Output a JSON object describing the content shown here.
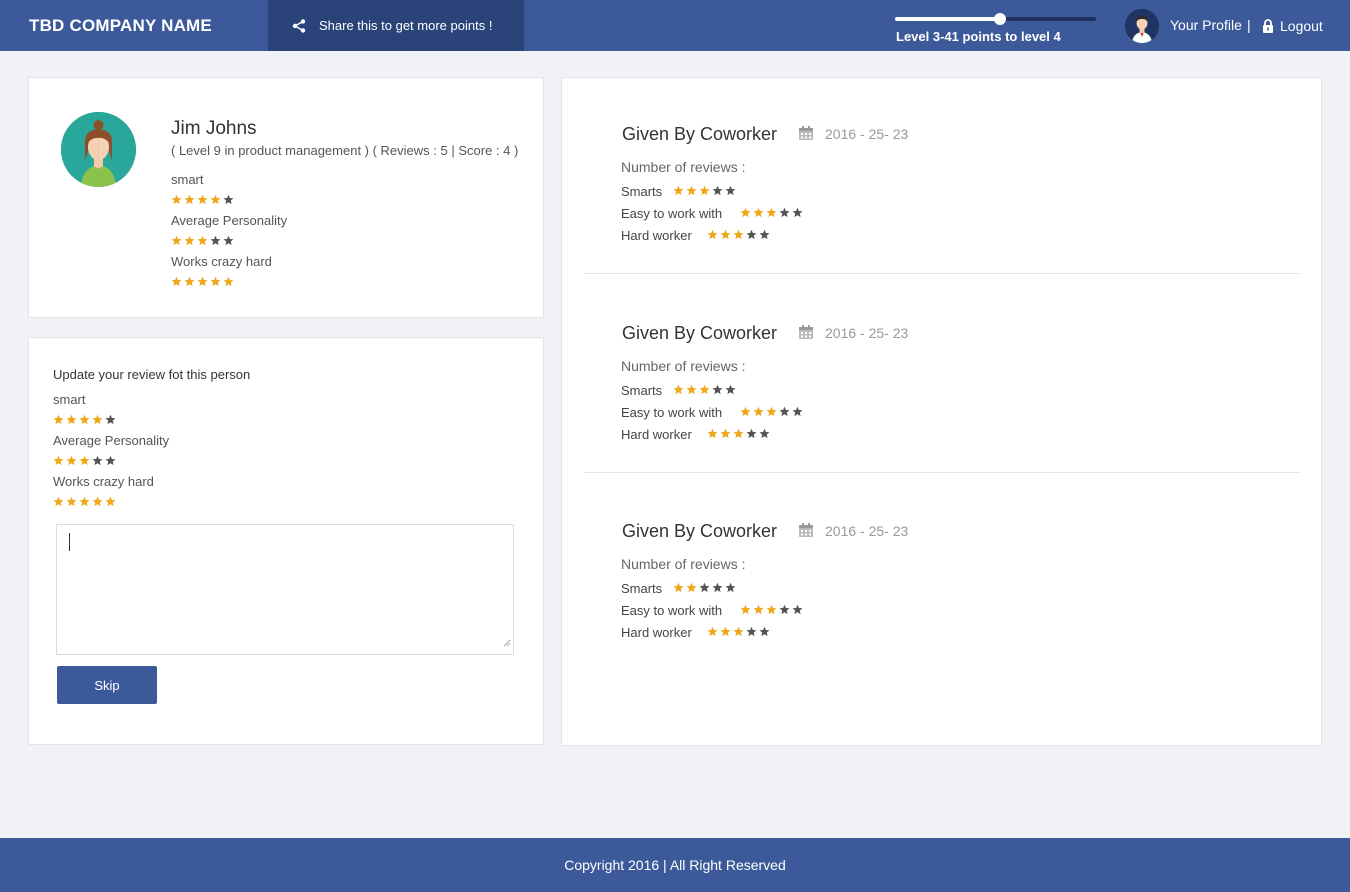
{
  "header": {
    "brand": "TBD COMPANY NAME",
    "share_label": "Share this to get more points !",
    "level_text": "Level 3-41 points to level 4",
    "level_progress": 0.52,
    "profile_label": "Your Profile",
    "separator": "|",
    "logout_label": "Logout"
  },
  "colors": {
    "primary": "#3c5a9a",
    "dark": "#2a4378",
    "star_on": "#f0a81b",
    "star_off": "#555555"
  },
  "profile": {
    "name": "Jim Johns",
    "meta": "( Level 9 in product management ) ( Reviews : 5 | Score : 4 )",
    "traits": [
      {
        "label": "smart",
        "rating": 4
      },
      {
        "label": "Average Personality",
        "rating": 3
      },
      {
        "label": "Works crazy hard",
        "rating": 5
      }
    ]
  },
  "review_form": {
    "title": "Update your review fot this person",
    "traits": [
      {
        "label": "smart",
        "rating": 4
      },
      {
        "label": "Average Personality",
        "rating": 3
      },
      {
        "label": "Works crazy hard",
        "rating": 5
      }
    ],
    "textarea_value": "",
    "skip_label": "Skip"
  },
  "feed": [
    {
      "given_by": "Given By Coworker",
      "date": "2016 - 25- 23",
      "num_label": "Number of reviews :",
      "criteria": [
        {
          "label": "Smarts",
          "rating": 3
        },
        {
          "label": "Easy to work with",
          "rating": 3
        },
        {
          "label": "Hard worker",
          "rating": 3
        }
      ]
    },
    {
      "given_by": "Given By Coworker",
      "date": "2016 - 25- 23",
      "num_label": "Number of reviews :",
      "criteria": [
        {
          "label": "Smarts",
          "rating": 3
        },
        {
          "label": "Easy to work with",
          "rating": 3
        },
        {
          "label": "Hard worker",
          "rating": 3
        }
      ]
    },
    {
      "given_by": "Given By Coworker",
      "date": "2016 - 25- 23",
      "num_label": "Number of reviews :",
      "criteria": [
        {
          "label": "Smarts",
          "rating": 2
        },
        {
          "label": "Easy to work with",
          "rating": 3
        },
        {
          "label": "Hard worker",
          "rating": 3
        }
      ]
    }
  ],
  "footer": {
    "copyright": "Copyright 2016 | All Right Reserved"
  }
}
